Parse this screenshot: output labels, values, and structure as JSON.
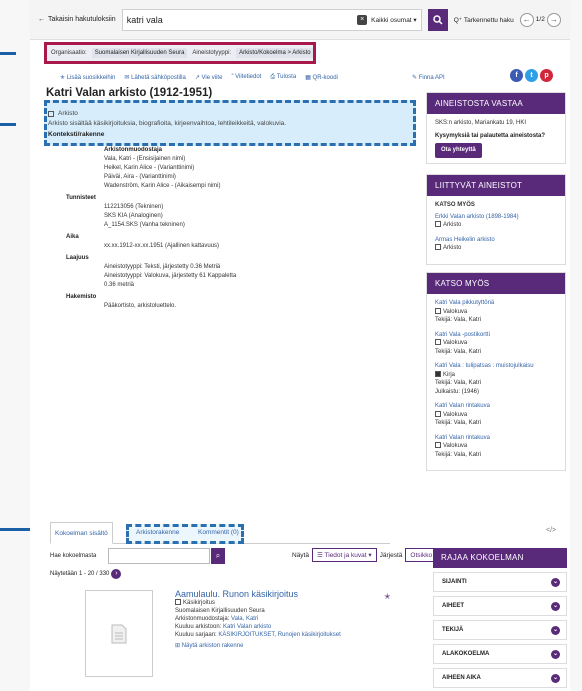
{
  "topbar": {
    "back_label": "Takaisin hakutuloksiin",
    "search_value": "katri vala",
    "scope": "Kaikki osumat",
    "advanced": "Tarkennettu haku",
    "pager": "1/2"
  },
  "breadcrumb": {
    "org_key": "Organisaatio:",
    "org_value": "Suomalaisen Kirjallisuuden Seura",
    "type_key": "Aineistotyyppi:",
    "type_value": "Arkisto/Kokoelma > Arkisto"
  },
  "toolbar": {
    "items": [
      "Lisää suosikkeihin",
      "Lähetä sähköpostilla",
      "Vie viite",
      "Viitetiedot",
      "Tulosta",
      "QR-koodi"
    ],
    "finna_api": "Finna API"
  },
  "record": {
    "title": "Katri Valan arkisto (1912-1951)",
    "format": "Arkisto",
    "description": "Arkisto sisältää käsikirjoituksia, biografioita, kirjeenvaihtoa, lehtileikkeitä, valokuvia.",
    "context": "Konteksti/rakenne"
  },
  "details": {
    "creator_head": "Arkistonmuodostaja",
    "creators": [
      "Vala, Katri - (Ensisijainen nimi)",
      "Heikel, Karin Alice - (Varianttinimi)",
      "Päiväi, Aira - (Varianttinimi)",
      "Wadenström, Karin Alice - (Aikaisempi nimi)"
    ],
    "ids_head": "Tunnisteet",
    "ids": [
      "112213056 (Tekninen)",
      "SKS KIA (Analoginen)",
      "A_1154.SKS (Vanha tekninen)"
    ],
    "time_head": "Aika",
    "time": "xx.xx.1912-xx.xx.1951 (Ajallinen kattavuus)",
    "extent_head": "Laajuus",
    "extent": [
      "Aineistotyyppi: Teksti, järjestetty 0.36 Metriä",
      "Aineistotyyppi: Valokuva, järjestetty 61 Kappaletta",
      "0.36 metriä"
    ],
    "index_head": "Hakemisto",
    "index": "Pääkortisto, arkistoluettelo."
  },
  "sidebar": {
    "responsible_head": "AINEISTOSTA VASTAA",
    "responsible_addr": "SKS:n arkisto, Mariankatu 19, HKI",
    "question": "Kysymyksiä tai palautetta aineistosta?",
    "contact_btn": "Ota yhteyttä",
    "related_head": "LIITTYVÄT AINEISTOT",
    "see_also_sub": "KATSO MYÖS",
    "related": [
      {
        "title": "Erkki Valan arkisto (1898-1984)",
        "format": "Arkisto"
      },
      {
        "title": "Armas Heikelin arkisto",
        "format": "Arkisto"
      }
    ],
    "see_also_head": "KATSO MYÖS",
    "see_also": [
      {
        "title": "Katri Vala pikkutyttönä",
        "format": "Valokuva",
        "extra": [
          "Tekijä: Vala, Katri"
        ]
      },
      {
        "title": "Katri Vala -postikortti",
        "format": "Valokuva",
        "extra": [
          "Tekijä: Vala, Katri"
        ]
      },
      {
        "title": "Katri Vala : tulipatsas : muistojulkaisu",
        "format": "Kirja",
        "extra": [
          "Tekijä: Vala, Katri",
          "Julkaistu: (1946)"
        ]
      },
      {
        "title": "Katri Valan rintakuva",
        "format": "Valokuva",
        "extra": [
          "Tekijä: Vala, Katri"
        ]
      },
      {
        "title": "Katri Valan rintakuva",
        "format": "Valokuva",
        "extra": [
          "Tekijä: Vala, Katri"
        ]
      }
    ]
  },
  "tabs": [
    "Kokoelman sisältö",
    "Arkistorakenne",
    "Kommentit (0)"
  ],
  "collection": {
    "search_label": "Hae kokoelmasta",
    "showing": "Näytetään 1 - 20 / 330",
    "view_label": "Näytä",
    "view_value": "Tiedot ja kuvat",
    "sort_label": "Järjestä",
    "sort_value": "Otsikko"
  },
  "result": {
    "title": "Aamulaulu. Runon käsikirjoitus",
    "format": "Käsikirjoitus",
    "org": "Suomalaisen Kirjallisuuden Seura",
    "creator_label": "Arkistonmuodostaja:",
    "creator": "Vala, Katri",
    "archive_label": "Kuuluu arkistoon:",
    "archive": "Katri Valan arkisto",
    "series_label": "Kuuluu sarjaan:",
    "series": "KÄSIKIRJOITUKSET, Runojen käsikirjoitukset",
    "structure": "Näytä arkiston rakenne"
  },
  "facets": {
    "head": "RAJAA KOKOELMAN SISÄLTÖÄ",
    "items": [
      "SIJAINTI",
      "AIHEET",
      "TEKIJÄ",
      "ALAKOKOELMA",
      "AIHEEN AIKA"
    ]
  },
  "colors": {
    "brand": "#5a2a7a",
    "highlight_red": "#a8184a",
    "highlight_blue": "#2a6fb0",
    "link": "#3565a8"
  }
}
